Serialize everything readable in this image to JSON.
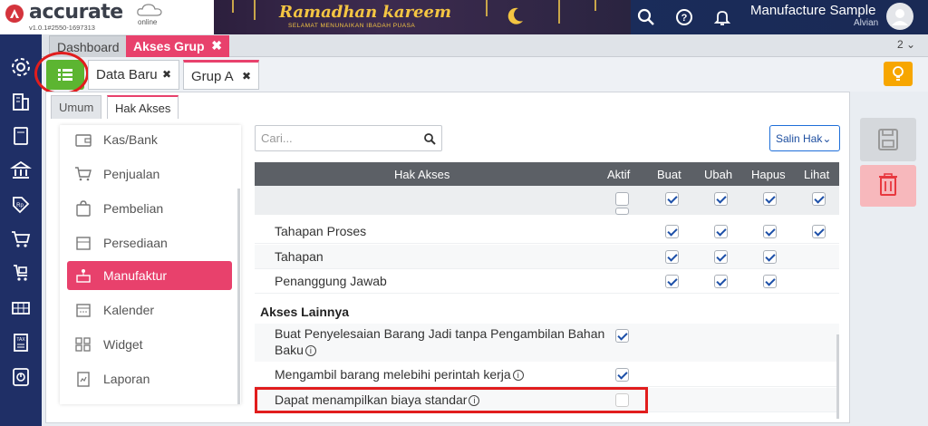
{
  "app": {
    "logo_text": "accurate",
    "logo_online": "online",
    "version": "v1.0.1#2550-1697313",
    "banner_title": "Ramadhan kareem",
    "banner_sub": "SELAMAT MENUNAIKAN IBADAH PUASA",
    "user_name": "Manufacture Sample",
    "user_sub": "Alvian"
  },
  "tabs": {
    "dashboard": "Dashboard",
    "akses_grup": "Akses Grup",
    "close": "✖",
    "count": "2 ⌄"
  },
  "subtabs": {
    "data_baru": "Data Baru",
    "grup_a": "Grup A",
    "close": "✖"
  },
  "inner_tabs": {
    "umum": "Umum",
    "hak_akses": "Hak Akses"
  },
  "left_menu": [
    {
      "label": "Kas/Bank",
      "icon": "wallet-icon"
    },
    {
      "label": "Penjualan",
      "icon": "cart-icon"
    },
    {
      "label": "Pembelian",
      "icon": "shopping-bag-icon"
    },
    {
      "label": "Persediaan",
      "icon": "box-icon"
    },
    {
      "label": "Manufaktur",
      "icon": "factory-icon",
      "active": true
    },
    {
      "label": "Kalender",
      "icon": "calendar-icon"
    },
    {
      "label": "Widget",
      "icon": "widget-icon"
    },
    {
      "label": "Laporan",
      "icon": "report-icon"
    }
  ],
  "search": {
    "placeholder": "Cari..."
  },
  "salin_button": "Salin Hak⌄",
  "grid": {
    "headers": {
      "hak_akses": "Hak Akses",
      "aktif": "Aktif",
      "buat": "Buat",
      "ubah": "Ubah",
      "hapus": "Hapus",
      "lihat": "Lihat"
    },
    "rows": [
      {
        "label": "Tahapan Proses",
        "aktif": null,
        "buat": true,
        "ubah": true,
        "hapus": true,
        "lihat": true
      },
      {
        "label": "Tahapan",
        "aktif": null,
        "buat": true,
        "ubah": true,
        "hapus": true,
        "lihat": null
      },
      {
        "label": "Penanggung Jawab",
        "aktif": null,
        "buat": true,
        "ubah": true,
        "hapus": true,
        "lihat": null
      }
    ],
    "section_title": "Akses Lainnya",
    "other_rows": [
      {
        "label_line1": "Buat Penyelesaian Barang Jadi tanpa Pengambilan Bahan",
        "label_line2": "Baku",
        "aktif": true
      },
      {
        "label": "Mengambil barang melebihi perintah kerja",
        "aktif": true
      },
      {
        "label": "Dapat menampilkan biaya standar",
        "aktif": false
      }
    ]
  },
  "colors": {
    "accent": "#e8416c",
    "sidebar": "#1f2f66",
    "highlight": "#e11d1d",
    "green": "#5cb531"
  }
}
